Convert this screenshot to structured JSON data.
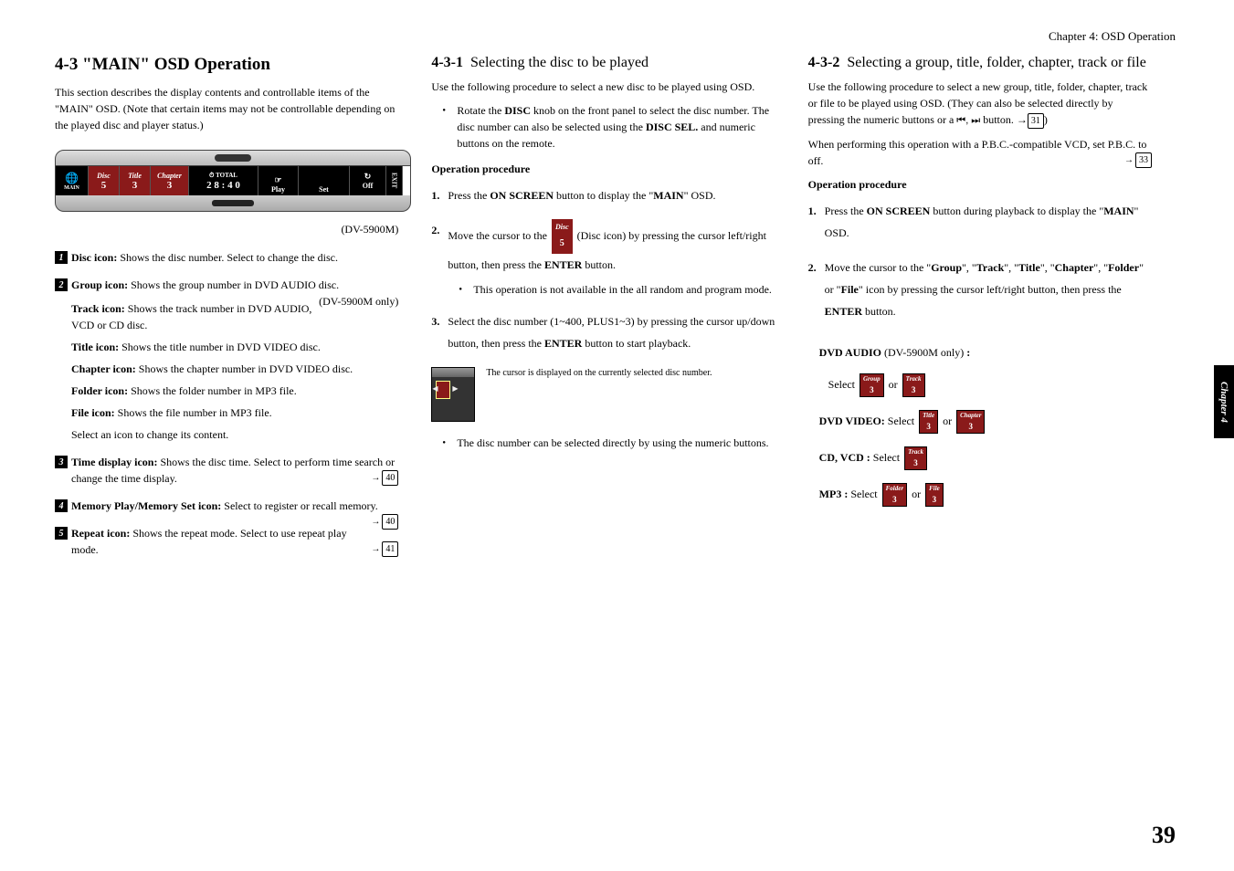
{
  "chapter_header": "Chapter 4: OSD Operation",
  "side_tab": "Chapter 4",
  "page_number": "39",
  "section_title": "4-3  \"MAIN\" OSD Operation",
  "section_intro": "This section describes the display contents and controllable items of the \"MAIN\" OSD.  (Note that certain items may not be controllable depending on the played disc and player status.)",
  "osd": {
    "main_label": "MAIN",
    "disc_label": "Disc",
    "disc_val": "5",
    "title_label": "Title",
    "title_val": "3",
    "chapter_label": "Chapter",
    "chapter_val": "3",
    "total_label": "TOTAL",
    "time_val": "2 8 : 4 0",
    "play_label": "Play",
    "set_label": "Set",
    "off_label": "Off",
    "exit_label": "EXIT"
  },
  "model": "(DV-5900M)",
  "items": [
    {
      "num": "1",
      "lead": "Disc icon:",
      "body": " Shows the disc number. Select to change the disc."
    },
    {
      "num": "2",
      "lead": "Group icon:",
      "body": " Shows the group number in DVD AUDIO disc.",
      "right_note": "(DV-5900M only)",
      "subs": [
        {
          "lead": "Track icon:",
          "body": " Shows the track number in DVD AUDIO, VCD or CD disc."
        },
        {
          "lead": "Title icon:",
          "body": " Shows the title number in DVD VIDEO disc."
        },
        {
          "lead": "Chapter icon:",
          "body": " Shows the chapter number in DVD VIDEO disc."
        },
        {
          "lead": "Folder icon:",
          "body": " Shows the folder number in MP3 file."
        },
        {
          "lead": "File icon:",
          "body": " Shows the file number in MP3 file."
        }
      ],
      "tail": "Select an icon to change its content."
    },
    {
      "num": "3",
      "lead": "Time display icon:",
      "body": " Shows the disc time. Select to perform time search or change the time display.",
      "page": "40"
    },
    {
      "num": "4",
      "lead": "Memory Play/Memory Set icon:",
      "body": " Select to register or recall memory.",
      "page": "40"
    },
    {
      "num": "5",
      "lead": "Repeat icon:",
      "body": " Shows the repeat mode. Select to use repeat play mode.",
      "page": "41"
    }
  ],
  "sub431": {
    "num": "4-3-1",
    "title": "Selecting the disc to be played",
    "intro": "Use the following procedure to select a new disc to be played using OSD.",
    "rotate_pre": "Rotate the ",
    "rotate_bold1": "DISC",
    "rotate_mid": " knob on the front panel to select the disc number. The disc number can also be selected using the ",
    "rotate_bold2": "DISC SEL.",
    "rotate_post": " and numeric buttons on the remote.",
    "op_head": "Operation procedure",
    "step1_pre": "Press the ",
    "step1_bold": "ON SCREEN",
    "step1_mid": " button to display the \"",
    "step1_main": "MAIN",
    "step1_post": "\" OSD.",
    "step2_pre": "Move the cursor to the ",
    "chip_label": "Disc",
    "chip_val": "5",
    "step2_mid": " (Disc icon) by pressing the cursor left/right button, then press the ",
    "step2_bold": "ENTER",
    "step2_post": " button.",
    "step2_bullet": "This operation is not available in the all random and program mode.",
    "step3_pre": "Select the disc number (1~400, PLUS1~3) by pressing the cursor up/down button, then press the ",
    "step3_bold": "ENTER",
    "step3_post": " button to start playback.",
    "thumb_caption": "The cursor is displayed on the currently selected disc number.",
    "final_bullet": "The disc number can be selected directly by using the numeric buttons."
  },
  "sub432": {
    "num": "4-3-2",
    "title": "Selecting a group, title, folder, chapter, track or file",
    "intro_pre": "Use the following procedure to select a new group, title, folder, chapter, track or file to be played using OSD. (They can also be selected directly by pressing the numeric buttons or a ",
    "intro_btn": "⏮, ⏭",
    "intro_post1": " button. →",
    "intro_page": "31",
    "intro_post2": ")",
    "note_pre": "When performing this operation with a P.B.C.-compatible VCD, set P.B.C. to off.",
    "note_page": "33",
    "op_head": "Operation procedure",
    "step1_pre": "Press the ",
    "step1_bold": "ON SCREEN",
    "step1_mid": " button during playback to display the \"",
    "step1_main": "MAIN",
    "step1_post": "\" OSD.",
    "step2_pre": "Move the cursor to the \"",
    "s2a": "Group",
    "s2b": "Track",
    "s2c": "Title",
    "s2d": "Chapter",
    "s2e": "Folder",
    "s2f": "File",
    "step2_mid1": "\", \"",
    "step2_mid2": "\" or \"",
    "step2_post1": "\" icon by pressing the cursor left/right button, then press the ",
    "step2_bold": "ENTER",
    "step2_post2": " button.",
    "dvda_label_pre": "DVD AUDIO",
    "dvda_model": " (DV-5900M only) ",
    "colon": ":",
    "select_word": "Select ",
    "or_word": " or ",
    "dvdv_label": "DVD VIDEO:",
    "cdvcd_label": "CD, VCD :",
    "mp3_label": "MP3 :",
    "chips": {
      "group": {
        "l": "Group",
        "v": "3"
      },
      "track": {
        "l": "Track",
        "v": "3"
      },
      "title": {
        "l": "Title",
        "v": "3"
      },
      "chapter": {
        "l": "Chapter",
        "v": "3"
      },
      "folder": {
        "l": "Folder",
        "v": "3"
      },
      "file": {
        "l": "File",
        "v": "3"
      }
    }
  }
}
